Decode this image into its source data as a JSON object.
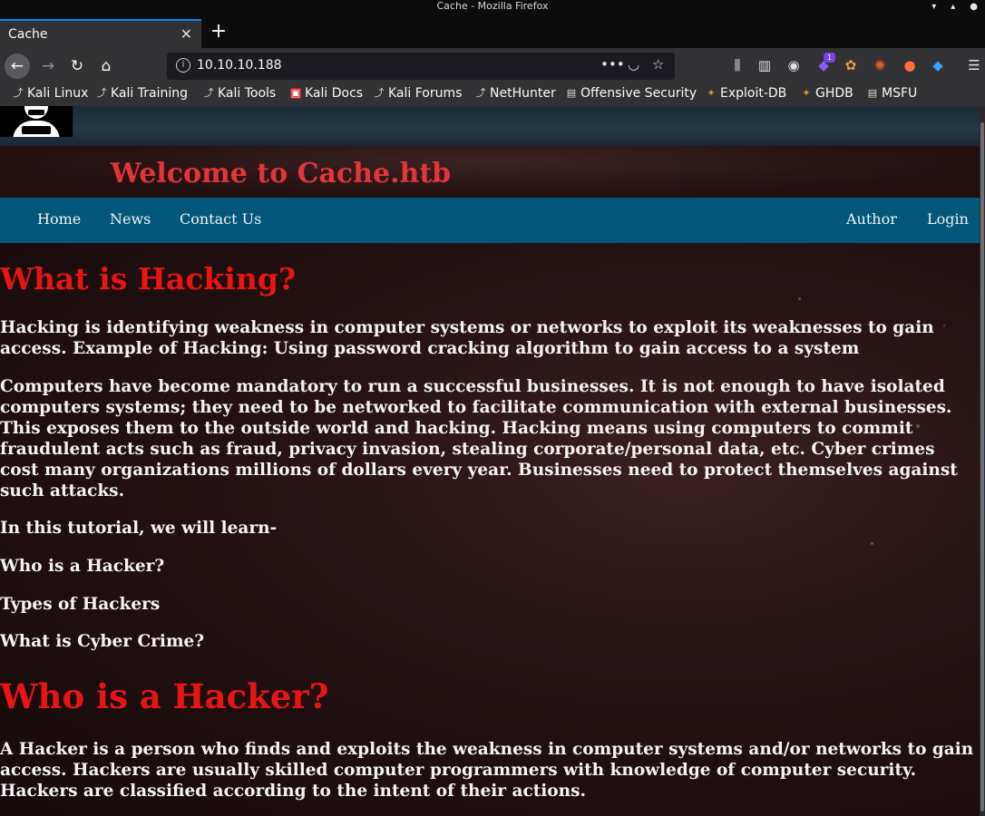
{
  "window": {
    "title": "Cache - Mozilla Firefox"
  },
  "tabs": [
    {
      "label": "Cache"
    }
  ],
  "urlbar": {
    "url": "10.10.10.188"
  },
  "toolbar": {
    "badge_count": "1"
  },
  "bookmarks": [
    {
      "label": "Kali Linux"
    },
    {
      "label": "Kali Training"
    },
    {
      "label": "Kali Tools"
    },
    {
      "label": "Kali Docs"
    },
    {
      "label": "Kali Forums"
    },
    {
      "label": "NetHunter"
    },
    {
      "label": "Offensive Security"
    },
    {
      "label": "Exploit-DB"
    },
    {
      "label": "GHDB"
    },
    {
      "label": "MSFU"
    }
  ],
  "site": {
    "title": "Welcome to Cache.htb",
    "nav_left": [
      {
        "label": "Home"
      },
      {
        "label": "News"
      },
      {
        "label": "Contact Us"
      }
    ],
    "nav_right": [
      {
        "label": "Author"
      },
      {
        "label": "Login"
      }
    ],
    "heading1": "What is Hacking?",
    "p1": "Hacking is identifying weakness in computer systems or networks to exploit its weaknesses to gain access. Example of Hacking: Using password cracking algorithm to gain access to a system",
    "p2": "Computers have become mandatory to run a successful businesses. It is not enough to have isolated computers systems; they need to be networked to facilitate communication with external businesses. This exposes them to the outside world and hacking. Hacking means using computers to commit fraudulent acts such as fraud, privacy invasion, stealing corporate/personal data, etc. Cyber crimes cost many organizations millions of dollars every year. Businesses need to protect themselves against such attacks.",
    "p3": "In this tutorial, we will learn-",
    "p4": "Who is a Hacker?",
    "p5": "Types of Hackers",
    "p6": "What is Cyber Crime?",
    "heading2": "Who is a Hacker?",
    "p7": "A Hacker is a person who finds and exploits the weakness in computer systems and/or networks to gain access. Hackers are usually skilled computer programmers with knowledge of computer security. Hackers are classified according to the intent of their actions."
  },
  "colors": {
    "heading": "#e81515",
    "site_title": "#e0363a",
    "menubar": "#03577b",
    "tab_accent": "#0a84ff"
  }
}
